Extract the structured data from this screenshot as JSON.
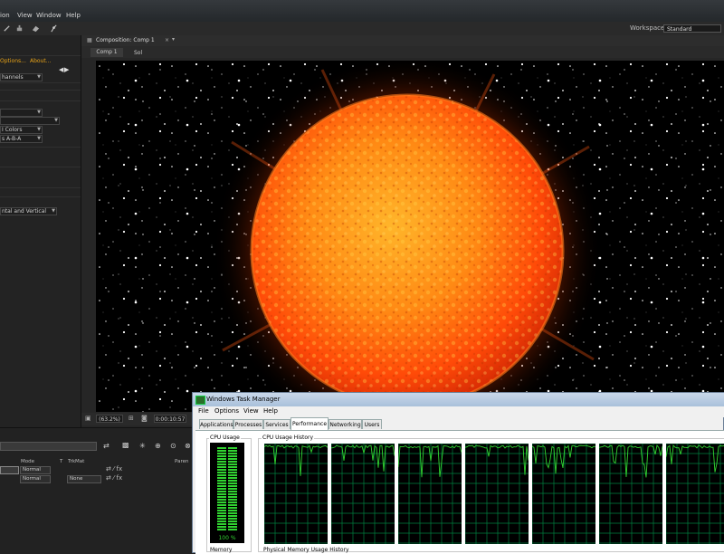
{
  "menubar": {
    "items": [
      "ion",
      "View",
      "Window",
      "Help"
    ]
  },
  "workspace": {
    "label": "Workspace:",
    "value": "Standard"
  },
  "left_panel": {
    "tab_links": [
      "Options...",
      "About..."
    ],
    "rows": [
      "hannels",
      "",
      "",
      "I Colors",
      "s A-B-A",
      "ntal and Vertical"
    ]
  },
  "composition": {
    "panel_title": "Composition: Comp 1",
    "tabs": [
      "Comp 1",
      "Sol"
    ],
    "zoom": "(63.2%)",
    "timecode": "0:00:10:57"
  },
  "timeline": {
    "columns": [
      "Mode",
      "T",
      "TrkMat",
      "Paren"
    ],
    "layers": [
      {
        "mode": "Normal",
        "trkmat": ""
      },
      {
        "mode": "Normal",
        "trkmat": "None"
      }
    ]
  },
  "task_manager": {
    "title": "Windows Task Manager",
    "menu": [
      "File",
      "Options",
      "View",
      "Help"
    ],
    "tabs": [
      "Applications",
      "Processes",
      "Services",
      "Performance",
      "Networking",
      "Users"
    ],
    "active_tab": "Performance",
    "cpu_usage_label": "CPU Usage",
    "cpu_history_label": "CPU Usage History",
    "cpu_percent_text": "100 %",
    "cpu_level": 1.0,
    "memory_label": "Memory",
    "memory_history_label": "Physical Memory Usage History"
  },
  "colors": {
    "accent_orange": "#e8a317",
    "meter_green": "#31d331",
    "grid_green": "#008040"
  }
}
